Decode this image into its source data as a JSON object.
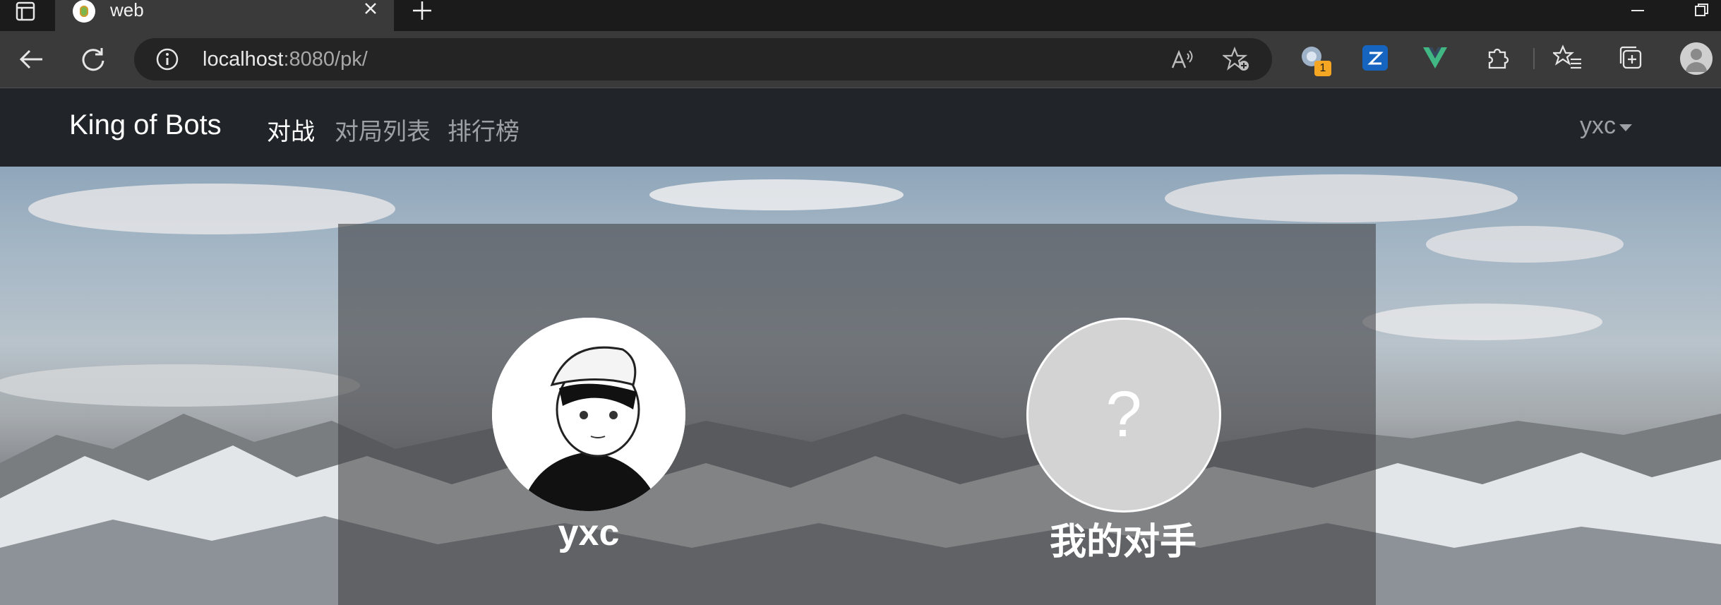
{
  "browser": {
    "tab_title": "web",
    "url_host": "localhost",
    "url_path": ":8080/pk/",
    "extension_badge": "1"
  },
  "navbar": {
    "brand": "King of Bots",
    "links": [
      "对战",
      "对局列表",
      "排行榜"
    ],
    "active_link": "对战",
    "username": "yxc"
  },
  "match": {
    "self_name": "yxc",
    "opponent_name": "我的对手",
    "opponent_placeholder": "?"
  },
  "colors": {
    "navbar_bg": "#212529",
    "nav_active": "#ffffff",
    "nav_inactive": "#9da1a6"
  },
  "icons": {
    "tab_actions": "tab-actions-icon",
    "favicon": "vue-app-favicon",
    "back": "back-arrow-icon",
    "refresh": "refresh-icon",
    "site_info": "info-circle-icon",
    "read_aloud": "read-aloud-icon",
    "add_favorite": "star-plus-icon",
    "extensions": "puzzle-icon",
    "favorites": "favorites-list-icon",
    "collections": "collections-icon"
  }
}
